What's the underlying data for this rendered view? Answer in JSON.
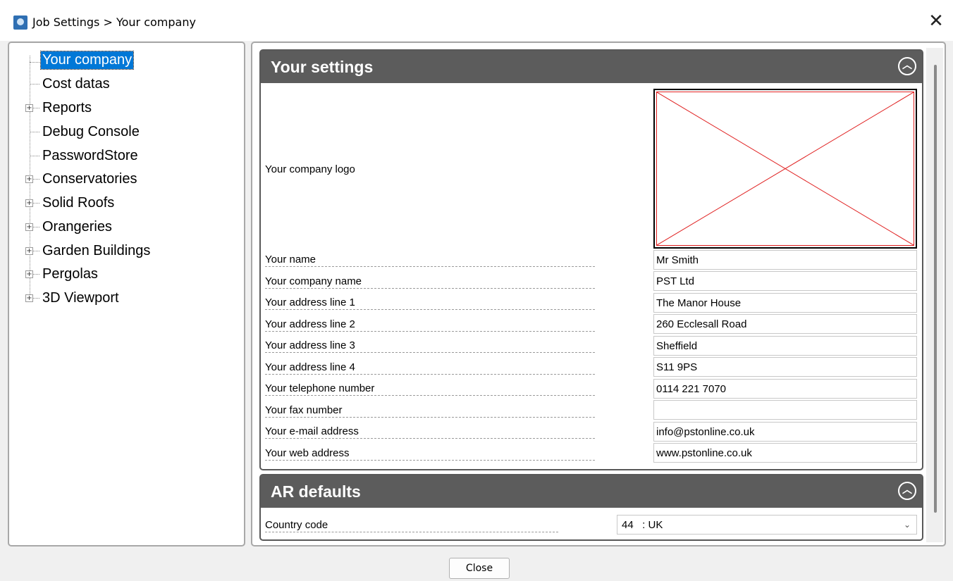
{
  "window": {
    "title": "Job Settings > Your company",
    "close_glyph": "✕",
    "icon": "app-logo-icon"
  },
  "tree": {
    "items": [
      {
        "label": "Your company",
        "expandable": false,
        "selected": true
      },
      {
        "label": "Cost datas",
        "expandable": false,
        "selected": false
      },
      {
        "label": "Reports",
        "expandable": true,
        "selected": false
      },
      {
        "label": "Debug Console",
        "expandable": false,
        "selected": false
      },
      {
        "label": "PasswordStore",
        "expandable": false,
        "selected": false
      },
      {
        "label": "Conservatories",
        "expandable": true,
        "selected": false
      },
      {
        "label": "Solid Roofs",
        "expandable": true,
        "selected": false
      },
      {
        "label": "Orangeries",
        "expandable": true,
        "selected": false
      },
      {
        "label": "Garden Buildings",
        "expandable": true,
        "selected": false
      },
      {
        "label": "Pergolas",
        "expandable": true,
        "selected": false
      },
      {
        "label": "3D Viewport",
        "expandable": true,
        "selected": false
      }
    ],
    "expander_glyph": "+"
  },
  "your_settings": {
    "title": "Your settings",
    "collapse_glyph": "︿",
    "logo_label": "Your company logo",
    "logo_placeholder_color": "#e02020",
    "fields": [
      {
        "label": "Your name",
        "value": "Mr Smith"
      },
      {
        "label": "Your company name",
        "value": "PST Ltd"
      },
      {
        "label": "Your address line 1",
        "value": "The Manor House"
      },
      {
        "label": "Your address line 2",
        "value": "260 Ecclesall Road"
      },
      {
        "label": "Your address line 3",
        "value": "Sheffield"
      },
      {
        "label": "Your address line 4",
        "value": "S11 9PS"
      },
      {
        "label": "Your telephone number",
        "value": "0114 221 7070"
      },
      {
        "label": "Your fax number",
        "value": ""
      },
      {
        "label": "Your e-mail address",
        "value": "info@pstonline.co.uk"
      },
      {
        "label": "Your web address",
        "value": "www.pstonline.co.uk"
      }
    ]
  },
  "ar_defaults": {
    "title": "AR defaults",
    "collapse_glyph": "︿",
    "country_code_label": "Country code",
    "country_code_value": "44   : UK",
    "chevron_glyph": "⌄"
  },
  "footer": {
    "close_label": "Close"
  },
  "colors": {
    "selection": "#0078d7",
    "section_header": "#5c5c5c"
  }
}
